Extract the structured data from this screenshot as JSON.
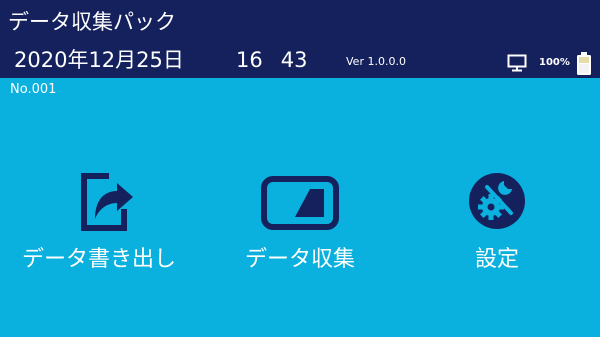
{
  "header": {
    "app_title": "データ収集パック",
    "date": "2020年12月25日",
    "time_hour": "16",
    "time_minute": "43",
    "version": "Ver 1.0.0.0",
    "battery_percent": "100%",
    "icons": [
      "monitor-icon",
      "battery-icon"
    ]
  },
  "device": {
    "serial": "No.001"
  },
  "menu": {
    "items": [
      {
        "label": "データ書き出し",
        "icon": "export-icon"
      },
      {
        "label": "データ収集",
        "icon": "scanner-icon"
      },
      {
        "label": "設定",
        "icon": "settings-icon"
      }
    ]
  },
  "colors": {
    "header_bg": "#14215d",
    "body_bg": "#0ab0de",
    "icon_color": "#14215d",
    "text": "#ffffff"
  }
}
